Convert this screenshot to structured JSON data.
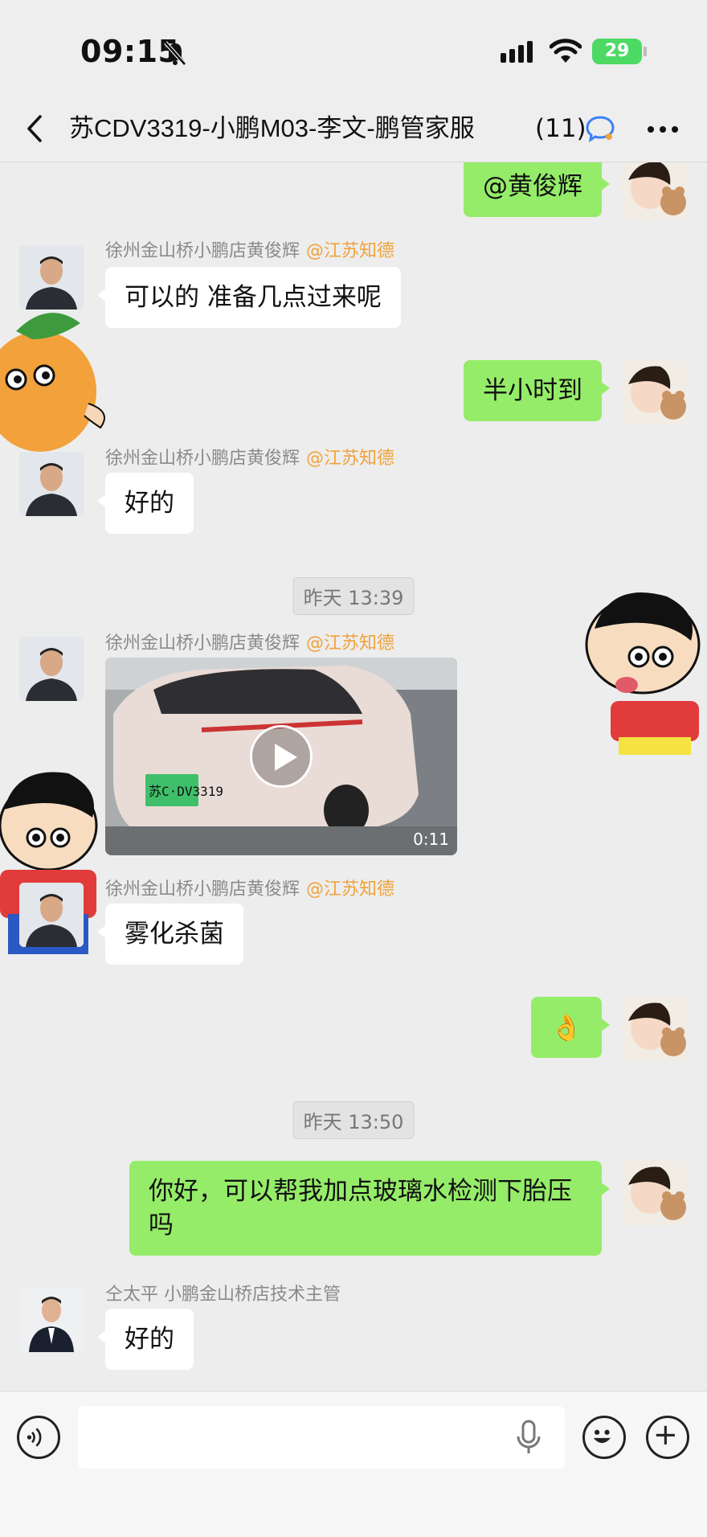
{
  "status": {
    "time": "09:15",
    "battery": "29"
  },
  "nav": {
    "title": "苏CDV3319-小鹏M03-李文-鹏管家服",
    "count": "(11)"
  },
  "messages": {
    "m0": {
      "text": "@黄俊辉"
    },
    "m1": {
      "sender": "徐州金山桥小鹏店黄俊辉",
      "mention": "@江苏知德",
      "text": "可以的  准备几点过来呢"
    },
    "m2": {
      "text": "半小时到"
    },
    "m3": {
      "sender": "徐州金山桥小鹏店黄俊辉",
      "mention": "@江苏知德",
      "text": "好的"
    },
    "t1": "昨天 13:39",
    "m4": {
      "sender": "徐州金山桥小鹏店黄俊辉",
      "mention": "@江苏知德",
      "duration": "0:11",
      "plate": "苏C·DV3319"
    },
    "m5": {
      "sender": "徐州金山桥小鹏店黄俊辉",
      "mention": "@江苏知德",
      "text": "雾化杀菌"
    },
    "m6": {
      "emoji": "👌"
    },
    "t2": "昨天 13:50",
    "m7": {
      "text": "你好，可以帮我加点玻璃水检测下胎压吗"
    },
    "m8": {
      "sender": "仝太平 小鹏金山桥店技术主管",
      "text": "好的"
    }
  },
  "input": {
    "placeholder": ""
  },
  "colors": {
    "bubble_me": "#95ec69",
    "bubble_other": "#ffffff",
    "mention": "#f0a23a",
    "battery": "#4cd964"
  },
  "icons": [
    "back-icon",
    "chat-icon",
    "more-icon",
    "voice-icon",
    "mic-icon",
    "emoji-icon",
    "plus-icon",
    "bell-off-icon",
    "signal-icon",
    "wifi-icon"
  ]
}
